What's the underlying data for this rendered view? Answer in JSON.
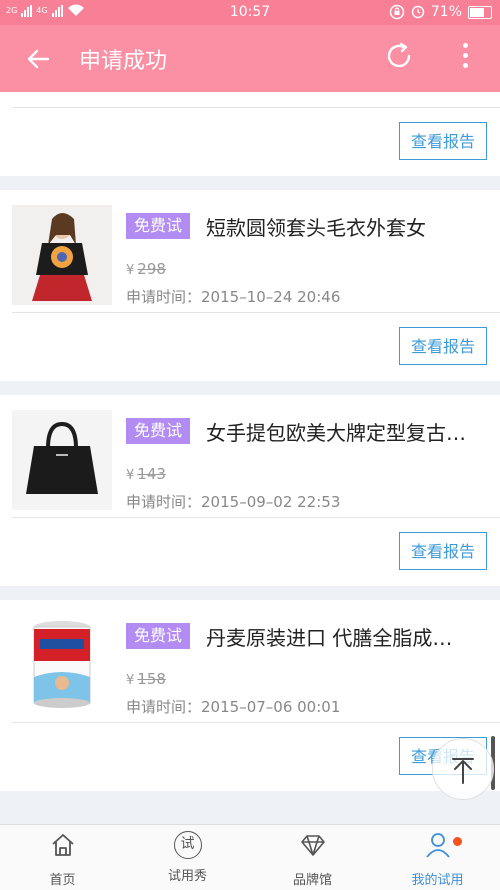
{
  "status_bar": {
    "signal_left": "2G",
    "signal_right": "4G",
    "time": "10:57",
    "battery": "71%"
  },
  "app_bar": {
    "title": "申请成功"
  },
  "report_button_label": "查看报告",
  "items": [
    {
      "badge": "免费试",
      "title": "短款圆领套头毛衣外套女",
      "currency": "¥",
      "price": "298",
      "date_label": "申请时间：",
      "date": "2015–10–24  20:46"
    },
    {
      "badge": "免费试",
      "title": "女手提包欧美大牌定型复古…",
      "currency": "¥",
      "price": "143",
      "date_label": "申请时间：",
      "date": "2015–09–02  22:53"
    },
    {
      "badge": "免费试",
      "title": "丹麦原装进口 代膳全脂成…",
      "currency": "¥",
      "price": "158",
      "date_label": "申请时间：",
      "date": "2015–07–06  00:01"
    }
  ],
  "bottom_nav": [
    {
      "label": "首页",
      "icon": "home-icon"
    },
    {
      "label": "试用秀",
      "icon": "trial-show-icon",
      "glyph": "试"
    },
    {
      "label": "品牌馆",
      "icon": "diamond-icon"
    },
    {
      "label": "我的试用",
      "icon": "user-icon",
      "active": true
    }
  ],
  "colors": {
    "appbar": "#fb8fa3",
    "badge": "#b28cf3",
    "accent": "#3e9bd8",
    "notify": "#f5531e"
  }
}
